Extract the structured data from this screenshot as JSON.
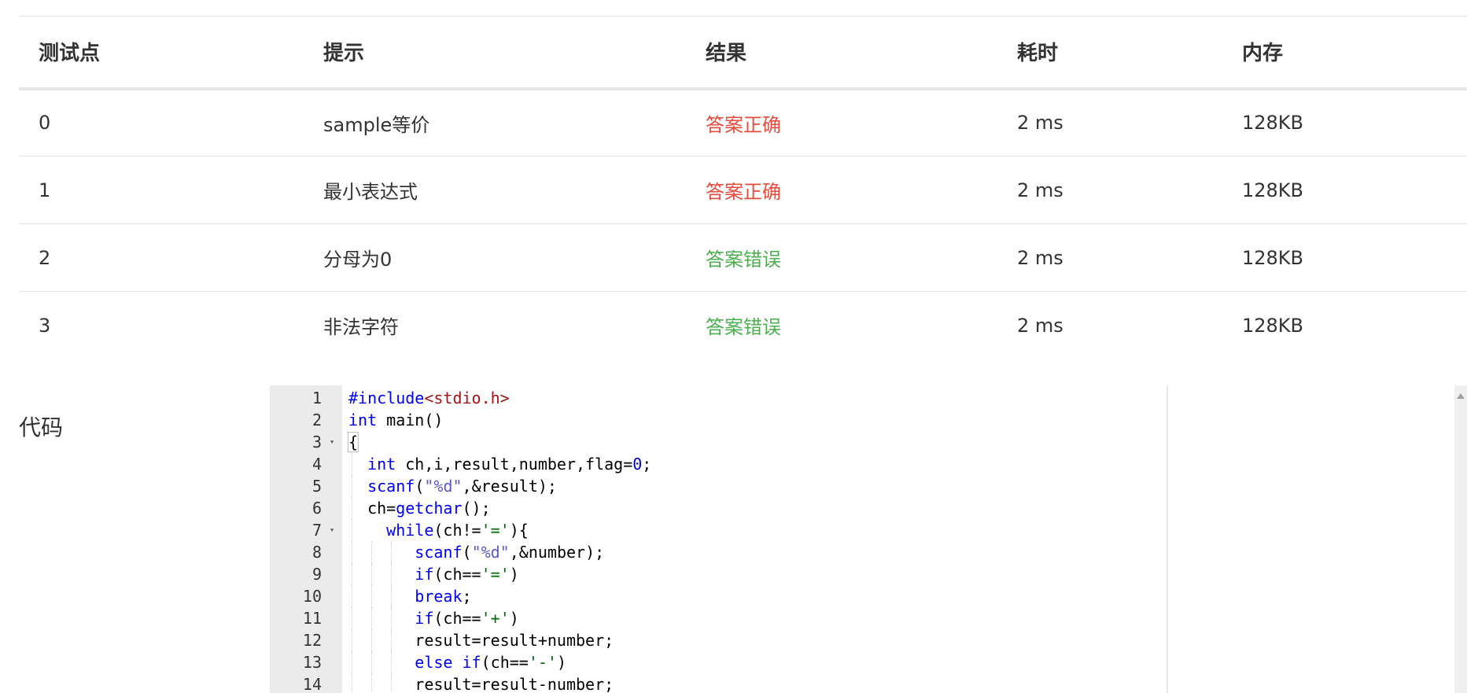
{
  "results": {
    "columns": [
      "测试点",
      "提示",
      "结果",
      "耗时",
      "内存"
    ],
    "rows": [
      {
        "id": "0",
        "hint": "sample等价",
        "result": "答案正确",
        "status": "pass",
        "time": "2 ms",
        "memory": "128KB"
      },
      {
        "id": "1",
        "hint": "最小表达式",
        "result": "答案正确",
        "status": "pass",
        "time": "2 ms",
        "memory": "128KB"
      },
      {
        "id": "2",
        "hint": "分母为0",
        "result": "答案错误",
        "status": "fail",
        "time": "2 ms",
        "memory": "128KB"
      },
      {
        "id": "3",
        "hint": "非法字符",
        "result": "答案错误",
        "status": "fail",
        "time": "2 ms",
        "memory": "128KB"
      }
    ]
  },
  "colors": {
    "pass": "#e74c3c",
    "fail": "#4caf50"
  },
  "code": {
    "label": "代码",
    "lines": [
      {
        "n": "1",
        "text": "#include<stdio.h>"
      },
      {
        "n": "2",
        "text": "int main()"
      },
      {
        "n": "3",
        "text": "{"
      },
      {
        "n": "4",
        "text": "  int ch,i,result,number,flag=0;"
      },
      {
        "n": "5",
        "text": "  scanf(\"%d\",&result);"
      },
      {
        "n": "6",
        "text": "  ch=getchar();"
      },
      {
        "n": "7",
        "text": "    while(ch!='='){"
      },
      {
        "n": "8",
        "text": "       scanf(\"%d\",&number);"
      },
      {
        "n": "9",
        "text": "       if(ch=='=')"
      },
      {
        "n": "10",
        "text": "       break;"
      },
      {
        "n": "11",
        "text": "       if(ch=='+')"
      },
      {
        "n": "12",
        "text": "       result=result+number;"
      },
      {
        "n": "13",
        "text": "       else if(ch=='-')"
      },
      {
        "n": "14",
        "text": "       result=result-number;"
      }
    ]
  },
  "icons": {
    "fold": "fold-arrow-icon",
    "scroll_up": "scroll-up-arrow-icon"
  }
}
